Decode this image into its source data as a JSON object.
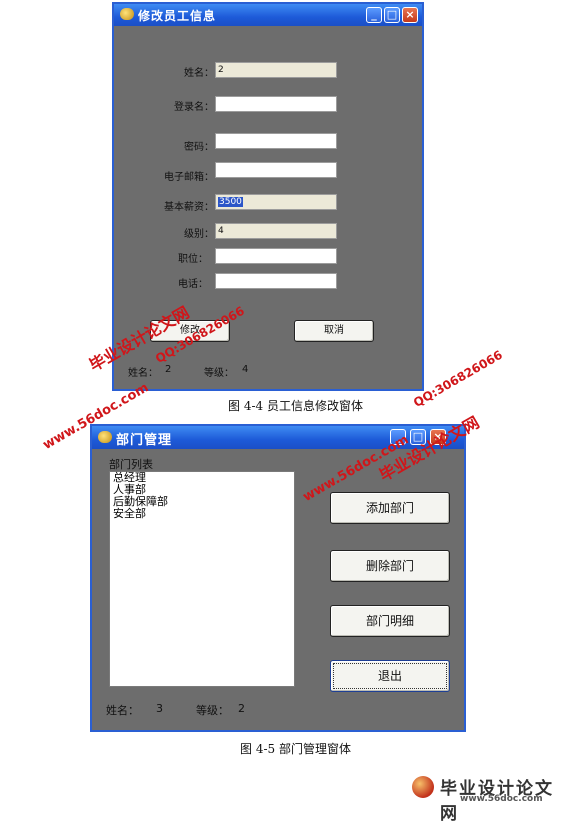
{
  "window1": {
    "title": "修改员工信息",
    "fields": [
      {
        "label": "姓名：",
        "value": "2"
      },
      {
        "label": "登录名：",
        "value": ""
      },
      {
        "label": "密码：",
        "value": ""
      },
      {
        "label": "电子邮箱：",
        "value": ""
      },
      {
        "label": "基本薪资：",
        "value": "3500"
      },
      {
        "label": "级别：",
        "value": "4"
      },
      {
        "label": "职位：",
        "value": ""
      },
      {
        "label": "电话：",
        "value": ""
      }
    ],
    "modify_button": "修改",
    "cancel_button": "取消",
    "status": {
      "name_label": "姓名：",
      "name_value": "2",
      "level_label": "等级：",
      "level_value": "4"
    }
  },
  "caption1": "图 4-4 员工信息修改窗体",
  "window2": {
    "title": "部门管理",
    "list_title": "部门列表",
    "departments": [
      "总经理",
      "人事部",
      "后勤保障部",
      "安全部"
    ],
    "buttons": [
      "添加部门",
      "删除部门",
      "部门明细",
      "退出"
    ],
    "status": {
      "name_label": "姓名：",
      "name_value": "3",
      "level_label": "等级：",
      "level_value": "2"
    }
  },
  "caption2": "图 4-5 部门管理窗体",
  "watermark": {
    "site_cn": "毕业设计论文网",
    "url": "www.56doc.com",
    "qq": "QQ:306826066"
  },
  "footer_logo": {
    "cn": "毕业设计论文网",
    "url": "www.56doc.com"
  }
}
